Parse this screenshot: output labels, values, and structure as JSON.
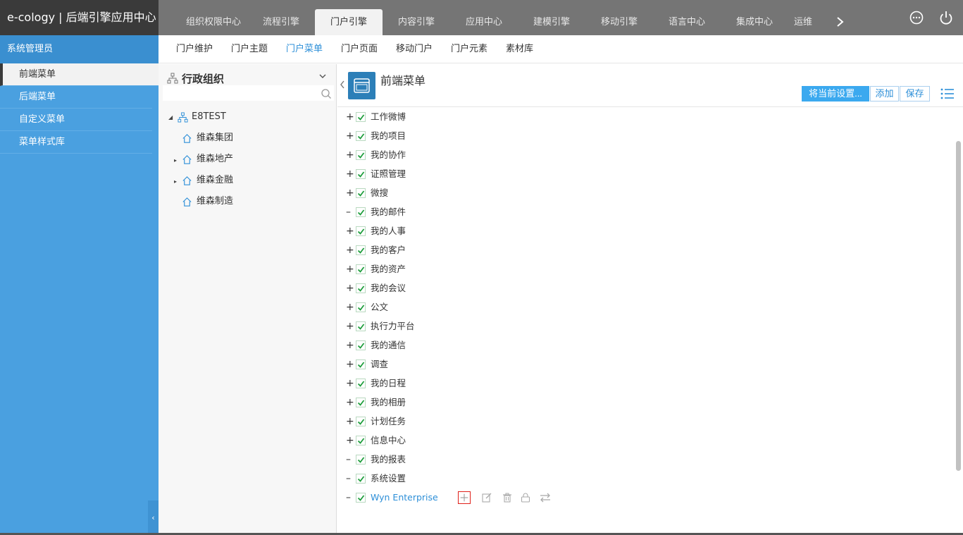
{
  "app": {
    "title": "e-cology | 后端引擎应用中心"
  },
  "top_tabs": [
    {
      "label": "组织权限中心"
    },
    {
      "label": "流程引擎"
    },
    {
      "label": "门户引擎"
    },
    {
      "label": "内容引擎"
    },
    {
      "label": "应用中心"
    },
    {
      "label": "建模引擎"
    },
    {
      "label": "移动引擎"
    },
    {
      "label": "语言中心"
    },
    {
      "label": "集成中心"
    },
    {
      "label": "运维"
    }
  ],
  "top_icons": {
    "more": "more-circle-icon",
    "power": "power-icon"
  },
  "sidebar": {
    "header": "系统管理员",
    "items": [
      {
        "label": "前端菜单"
      },
      {
        "label": "后端菜单"
      },
      {
        "label": "自定义菜单"
      },
      {
        "label": "菜单样式库"
      }
    ]
  },
  "sub_tabs": [
    {
      "label": "门户维护"
    },
    {
      "label": "门户主题"
    },
    {
      "label": "门户菜单"
    },
    {
      "label": "门户页面"
    },
    {
      "label": "移动门户"
    },
    {
      "label": "门户元素"
    },
    {
      "label": "素材库"
    }
  ],
  "tree": {
    "title": "行政组织",
    "search_placeholder": "",
    "root": "E8TEST",
    "children": [
      {
        "label": "维森集团"
      },
      {
        "label": "维森地产"
      },
      {
        "label": "维森金融"
      },
      {
        "label": "维森制造"
      }
    ]
  },
  "main": {
    "title": "前端菜单",
    "buttons": {
      "apply": "将当前设置...",
      "add": "添加",
      "save": "保存"
    },
    "rows": [
      {
        "label": "工作微博",
        "expand": "+"
      },
      {
        "label": "我的项目",
        "expand": "+"
      },
      {
        "label": "我的协作",
        "expand": "+"
      },
      {
        "label": "证照管理",
        "expand": "+"
      },
      {
        "label": "微搜",
        "expand": "+"
      },
      {
        "label": "我的邮件",
        "expand": "–"
      },
      {
        "label": "我的人事",
        "expand": "+"
      },
      {
        "label": "我的客户",
        "expand": "+"
      },
      {
        "label": "我的资产",
        "expand": "+"
      },
      {
        "label": "我的会议",
        "expand": "+"
      },
      {
        "label": "公文",
        "expand": "+"
      },
      {
        "label": "执行力平台",
        "expand": "+"
      },
      {
        "label": "我的通信",
        "expand": "+"
      },
      {
        "label": "调查",
        "expand": "+"
      },
      {
        "label": "我的日程",
        "expand": "+"
      },
      {
        "label": "我的相册",
        "expand": "+"
      },
      {
        "label": "计划任务",
        "expand": "+"
      },
      {
        "label": "信息中心",
        "expand": "+"
      },
      {
        "label": "我的报表",
        "expand": "–"
      },
      {
        "label": "系统设置",
        "expand": "–"
      },
      {
        "label": "Wyn Enterprise",
        "expand": "–"
      }
    ]
  },
  "colors": {
    "accent": "#3ba9ef",
    "sidebar": "#4aa0e0",
    "topbar": "#757575",
    "focus": "#e0201a"
  }
}
